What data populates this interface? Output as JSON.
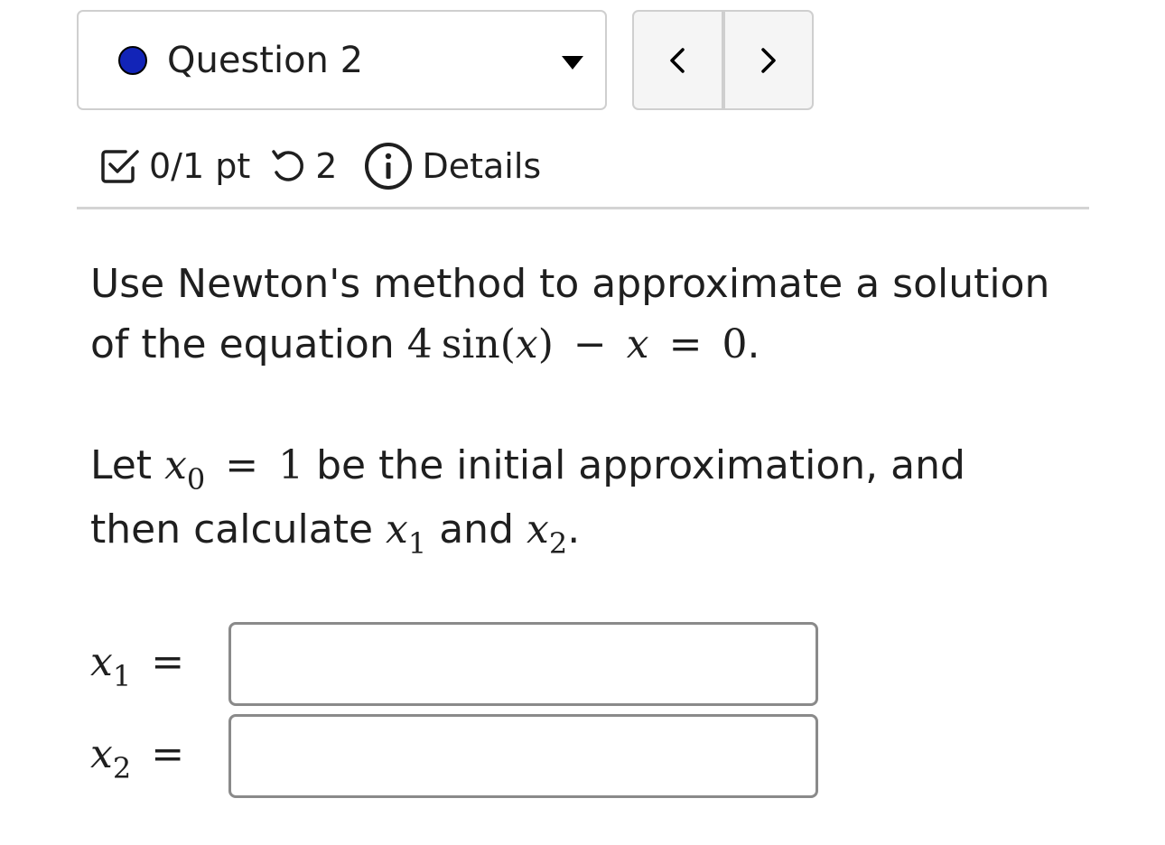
{
  "question_selector": {
    "label": "Question 2",
    "status_dot_color": "#1224b8",
    "icon": "chevron-down-icon"
  },
  "nav": {
    "prev_icon": "chevron-left-icon",
    "next_icon": "chevron-right-icon"
  },
  "meta": {
    "score": "0/1 pt",
    "attempts": "2",
    "details_label": "Details"
  },
  "question": {
    "line1_text": "Use Newton's method to approximate a solution",
    "line2_prefix": "of the equation ",
    "equation": {
      "coef": "4",
      "func": "sin",
      "open": "(",
      "var": "x",
      "close": ")",
      "minus": "−",
      "var2": "x",
      "equals": "=",
      "rhs": "0"
    },
    "line2_suffix": ".",
    "p2_prefix": "Let ",
    "x0_var": "x",
    "x0_sub": "0",
    "p2_eq": "=",
    "x0_value": "1",
    "p2_mid": " be the initial approximation, and",
    "p2_line2_prefix": "then calculate ",
    "x1_var": "x",
    "x1_sub": "1",
    "p2_and": " and ",
    "x2_var": "x",
    "x2_sub": "2",
    "p2_end": "."
  },
  "answers": [
    {
      "var": "x",
      "sub": "1",
      "equals": "=",
      "value": ""
    },
    {
      "var": "x",
      "sub": "2",
      "equals": "=",
      "value": ""
    }
  ]
}
